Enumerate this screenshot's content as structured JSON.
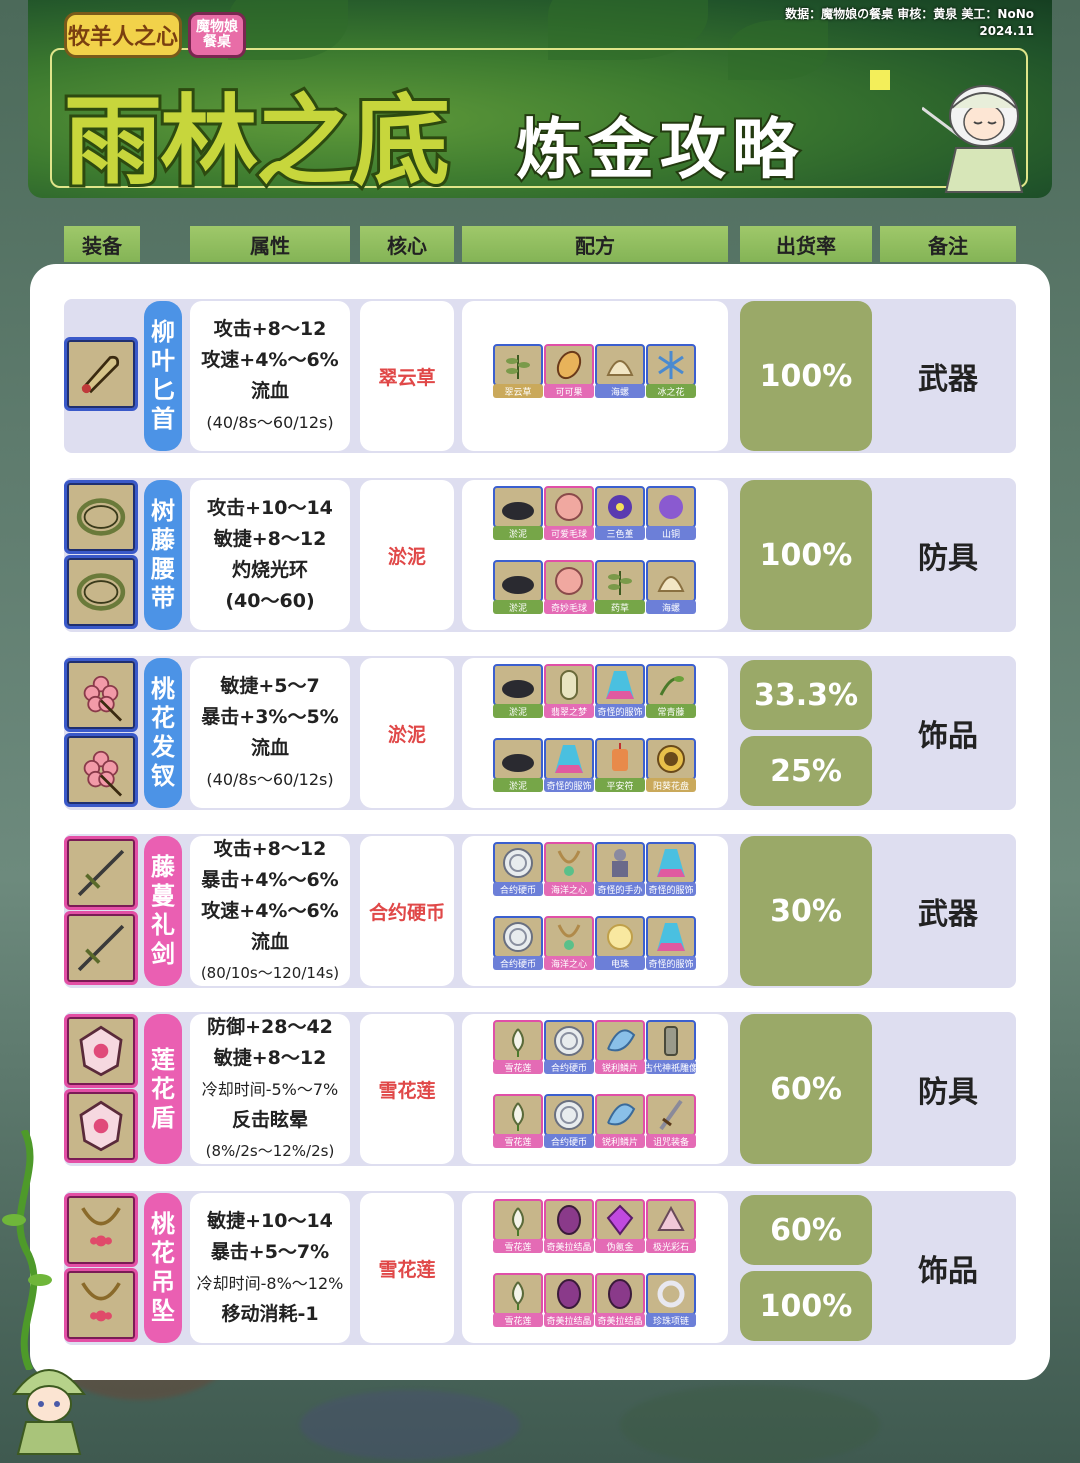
{
  "header": {
    "logo_left": "牧羊人之心",
    "logo_right": "魔物娘餐桌",
    "credit_line1": "数据：魔物娘の餐桌  审核：黄泉  美工：NoNo",
    "credit_line2": "2024.11",
    "title_main": "雨林之底",
    "title_sub": "炼金攻略"
  },
  "columns": [
    "装备",
    "属性",
    "核心",
    "配方",
    "出货率",
    "备注"
  ],
  "rows": [
    {
      "name": "柳叶匕首",
      "rarity": "blue",
      "attrs": [
        [
          "攻击+8～12",
          ""
        ],
        [
          "攻速+4%～6%",
          ""
        ],
        [
          "流血",
          ""
        ],
        [
          "(40/8s～60/12s)",
          "sm"
        ]
      ],
      "core": "翠云草",
      "recipes": [
        [
          {
            "label": "翠云草",
            "border": "blue",
            "tag": "gold",
            "icon": "herb-icon"
          },
          {
            "label": "可可果",
            "border": "pink",
            "tag": "pink",
            "icon": "cocoa-icon"
          },
          {
            "label": "海螺",
            "border": "blue",
            "tag": "blue",
            "icon": "shell-icon"
          },
          {
            "label": "冰之花",
            "border": "blue",
            "tag": "green",
            "icon": "ice-flower-icon"
          }
        ]
      ],
      "rates": [
        "100%"
      ],
      "note": "武器"
    },
    {
      "name": "树藤腰带",
      "rarity": "blue",
      "attrs": [
        [
          "攻击+10～14",
          ""
        ],
        [
          "敏捷+8～12",
          ""
        ],
        [
          "灼烧光环",
          ""
        ],
        [
          "(40～60)",
          ""
        ]
      ],
      "core": "淤泥",
      "recipes": [
        [
          {
            "label": "淤泥",
            "border": "blue",
            "tag": "green",
            "icon": "mud-icon"
          },
          {
            "label": "可爱毛球",
            "border": "pink",
            "tag": "pink",
            "icon": "furball-icon"
          },
          {
            "label": "三色堇",
            "border": "blue",
            "tag": "blue",
            "icon": "pansy-icon"
          },
          {
            "label": "山铜",
            "border": "blue",
            "tag": "blue",
            "icon": "ore-icon"
          }
        ],
        [
          {
            "label": "淤泥",
            "border": "blue",
            "tag": "green",
            "icon": "mud-icon"
          },
          {
            "label": "奇妙毛球",
            "border": "pink",
            "tag": "pink",
            "icon": "furball-icon"
          },
          {
            "label": "药草",
            "border": "blue",
            "tag": "green",
            "icon": "herb-icon"
          },
          {
            "label": "海螺",
            "border": "blue",
            "tag": "blue",
            "icon": "shell-icon"
          }
        ]
      ],
      "rates": [
        "100%"
      ],
      "note": "防具"
    },
    {
      "name": "桃花发钗",
      "rarity": "blue",
      "attrs": [
        [
          "敏捷+5～7",
          ""
        ],
        [
          "暴击+3%～5%",
          ""
        ],
        [
          "流血",
          ""
        ],
        [
          "(40/8s～60/12s)",
          "sm"
        ]
      ],
      "core": "淤泥",
      "recipes": [
        [
          {
            "label": "淤泥",
            "border": "blue",
            "tag": "green",
            "icon": "mud-icon"
          },
          {
            "label": "翡翠之梦",
            "border": "pink",
            "tag": "pink",
            "icon": "jade-icon"
          },
          {
            "label": "奇怪的服饰",
            "border": "blue",
            "tag": "blue",
            "icon": "cloth-icon"
          },
          {
            "label": "常青藤",
            "border": "blue",
            "tag": "green",
            "icon": "ivy-icon"
          }
        ],
        [
          {
            "label": "淤泥",
            "border": "blue",
            "tag": "green",
            "icon": "mud-icon"
          },
          {
            "label": "奇怪的服饰",
            "border": "blue",
            "tag": "blue",
            "icon": "cloth-icon"
          },
          {
            "label": "平安符",
            "border": "blue",
            "tag": "green",
            "icon": "charm-icon"
          },
          {
            "label": "阳葵花盘",
            "border": "blue",
            "tag": "gold",
            "icon": "sunflower-icon"
          }
        ]
      ],
      "rates": [
        "33.3%",
        "25%"
      ],
      "note": "饰品"
    },
    {
      "name": "藤蔓礼剑",
      "rarity": "pink",
      "attrs": [
        [
          "攻击+8～12",
          ""
        ],
        [
          "暴击+4%～6%",
          ""
        ],
        [
          "攻速+4%～6%",
          ""
        ],
        [
          "流血",
          ""
        ],
        [
          "(80/10s～120/14s)",
          "xs"
        ]
      ],
      "core": "合约硬币",
      "recipes": [
        [
          {
            "label": "合约硬币",
            "border": "blue",
            "tag": "blue",
            "icon": "coin-icon"
          },
          {
            "label": "海洋之心",
            "border": "pink",
            "tag": "pink",
            "icon": "necklace-icon"
          },
          {
            "label": "奇怪的手办",
            "border": "blue",
            "tag": "blue",
            "icon": "figure-icon"
          },
          {
            "label": "奇怪的服饰",
            "border": "blue",
            "tag": "blue",
            "icon": "cloth-icon"
          }
        ],
        [
          {
            "label": "合约硬币",
            "border": "blue",
            "tag": "blue",
            "icon": "coin-icon"
          },
          {
            "label": "海洋之心",
            "border": "pink",
            "tag": "pink",
            "icon": "necklace-icon"
          },
          {
            "label": "电珠",
            "border": "blue",
            "tag": "blue",
            "icon": "orb-icon"
          },
          {
            "label": "奇怪的服饰",
            "border": "blue",
            "tag": "blue",
            "icon": "cloth-icon"
          }
        ]
      ],
      "rates": [
        "30%"
      ],
      "note": "武器"
    },
    {
      "name": "莲花盾",
      "rarity": "pink",
      "attrs": [
        [
          "防御+28～42",
          ""
        ],
        [
          "敏捷+8～12",
          ""
        ],
        [
          "冷却时间-5%～7%",
          "sm"
        ],
        [
          "反击眩晕",
          ""
        ],
        [
          "(8%/2s～12%/2s)",
          "xs"
        ]
      ],
      "core": "雪花莲",
      "recipes": [
        [
          {
            "label": "雪花莲",
            "border": "pink",
            "tag": "pink",
            "icon": "snowdrop-icon"
          },
          {
            "label": "合约硬币",
            "border": "blue",
            "tag": "blue",
            "icon": "coin-icon"
          },
          {
            "label": "锐利鳞片",
            "border": "pink",
            "tag": "pink",
            "icon": "scale-icon"
          },
          {
            "label": "古代神祇雕像",
            "border": "blue",
            "tag": "blue",
            "icon": "statue-icon"
          }
        ],
        [
          {
            "label": "雪花莲",
            "border": "pink",
            "tag": "pink",
            "icon": "snowdrop-icon"
          },
          {
            "label": "合约硬币",
            "border": "blue",
            "tag": "blue",
            "icon": "coin-icon"
          },
          {
            "label": "锐利鳞片",
            "border": "pink",
            "tag": "pink",
            "icon": "scale-icon"
          },
          {
            "label": "诅咒装备",
            "border": "pink",
            "tag": "pink",
            "icon": "dagger-icon"
          }
        ]
      ],
      "rates": [
        "60%"
      ],
      "note": "防具"
    },
    {
      "name": "桃花吊坠",
      "rarity": "pink",
      "attrs": [
        [
          "敏捷+10～14",
          ""
        ],
        [
          "暴击+5～7%",
          ""
        ],
        [
          "冷却时间-8%～12%",
          "sm"
        ],
        [
          "移动消耗-1",
          ""
        ]
      ],
      "core": "雪花莲",
      "recipes": [
        [
          {
            "label": "雪花莲",
            "border": "pink",
            "tag": "pink",
            "icon": "snowdrop-icon"
          },
          {
            "label": "奇美拉结晶",
            "border": "pink",
            "tag": "pink",
            "icon": "crystal-egg-icon"
          },
          {
            "label": "伪氪金",
            "border": "pink",
            "tag": "pink",
            "icon": "gem-icon"
          },
          {
            "label": "极光彩石",
            "border": "pink",
            "tag": "pink",
            "icon": "aurora-stone-icon"
          }
        ],
        [
          {
            "label": "雪花莲",
            "border": "pink",
            "tag": "pink",
            "icon": "snowdrop-icon"
          },
          {
            "label": "奇美拉结晶",
            "border": "pink",
            "tag": "pink",
            "icon": "crystal-egg-icon"
          },
          {
            "label": "奇美拉结晶",
            "border": "pink",
            "tag": "pink",
            "icon": "crystal-egg-icon"
          },
          {
            "label": "珍珠项链",
            "border": "blue",
            "tag": "blue",
            "icon": "pearl-necklace-icon"
          }
        ]
      ],
      "rates": [
        "60%",
        "100%"
      ],
      "note": "饰品"
    }
  ]
}
